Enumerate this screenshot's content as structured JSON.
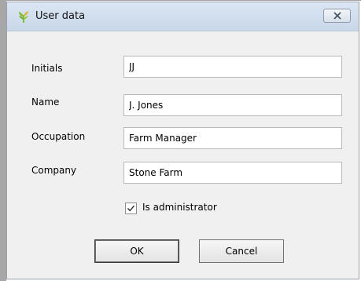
{
  "window": {
    "title": "User data",
    "icon": "leaf-icon",
    "close_icon": "close-icon"
  },
  "form": {
    "initials": {
      "label": "Initials",
      "value": "JJ"
    },
    "name": {
      "label": "Name",
      "value": "J. Jones"
    },
    "occupation": {
      "label": "Occupation",
      "value": "Farm Manager"
    },
    "company": {
      "label": "Company",
      "value": "Stone Farm"
    },
    "is_admin": {
      "label": "Is administrator",
      "checked": true
    }
  },
  "buttons": {
    "ok": "OK",
    "cancel": "Cancel"
  },
  "colors": {
    "icon_green": "#7fbf2a",
    "icon_yellow": "#e1b12c",
    "titlebar_top": "#dbe6f3",
    "titlebar_bottom": "#c8d7e9"
  }
}
